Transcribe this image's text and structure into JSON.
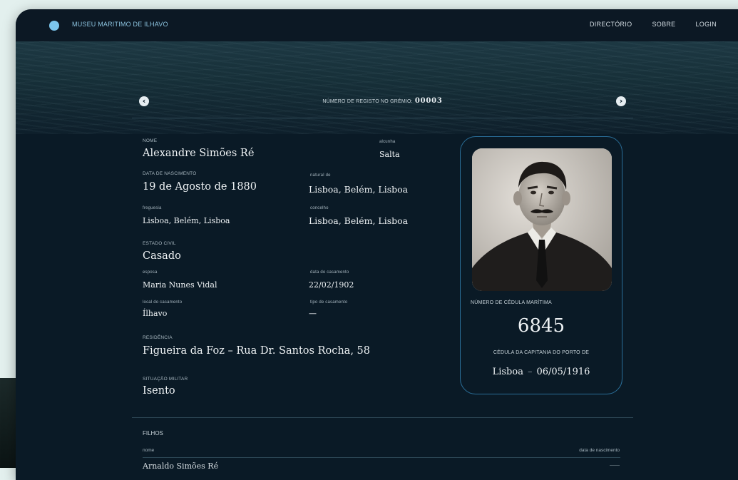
{
  "header": {
    "brand": "MUSEU MARITIMO DE ILHAVO",
    "nav": [
      "DIRECTÓRIO",
      "SOBRE",
      "LOGIN"
    ]
  },
  "registry": {
    "label": "NÚMERO DE REGISTO NO GRÉMIO:",
    "number": "00003"
  },
  "person": {
    "nome_label": "NOME",
    "nome": "Alexandre Simões Ré",
    "alcunha_label": "alcunha",
    "alcunha": "Salta",
    "nascimento_label": "DATA DE NASCIMENTO",
    "nascimento": "19 de Agosto de 1880",
    "natural_label": "natural de",
    "natural": "Lisboa, Belém, Lisboa",
    "freguesia_label": "freguesia",
    "freguesia": "Lisboa, Belém, Lisboa",
    "concelho_label": "concelho",
    "concelho": "Lisboa, Belém, Lisboa",
    "estado_label": "ESTADO CIVIL",
    "estado": "Casado",
    "esposa_label": "esposa",
    "esposa": "Maria Nunes Vidal",
    "data_casamento_label": "data do casamento",
    "data_casamento": "22/02/1902",
    "local_casamento_label": "local do casamento",
    "local_casamento": "Ílhavo",
    "tipo_casamento_label": "tipo de casamento",
    "tipo_casamento": "—",
    "residencia_label": "RESIDÊNCIA",
    "residencia": "Figueira da Foz – Rua Dr. Santos Rocha, 58",
    "militar_label": "SITUAÇÃO MILITAR",
    "militar": "Isento"
  },
  "card": {
    "cedula_label": "NÚMERO DE CÉDULA MARÍTIMA",
    "cedula": "6845",
    "capitania_label": "CÉDULA DA CAPITANIA DO PORTO DE",
    "porto": "Lisboa",
    "data": "06/05/1916"
  },
  "filhos": {
    "title": "FILHOS",
    "col_nome": "nome",
    "col_data": "data de nascimento",
    "first_row_name": "Arnaldo Simões Ré",
    "first_row_date": "——"
  }
}
